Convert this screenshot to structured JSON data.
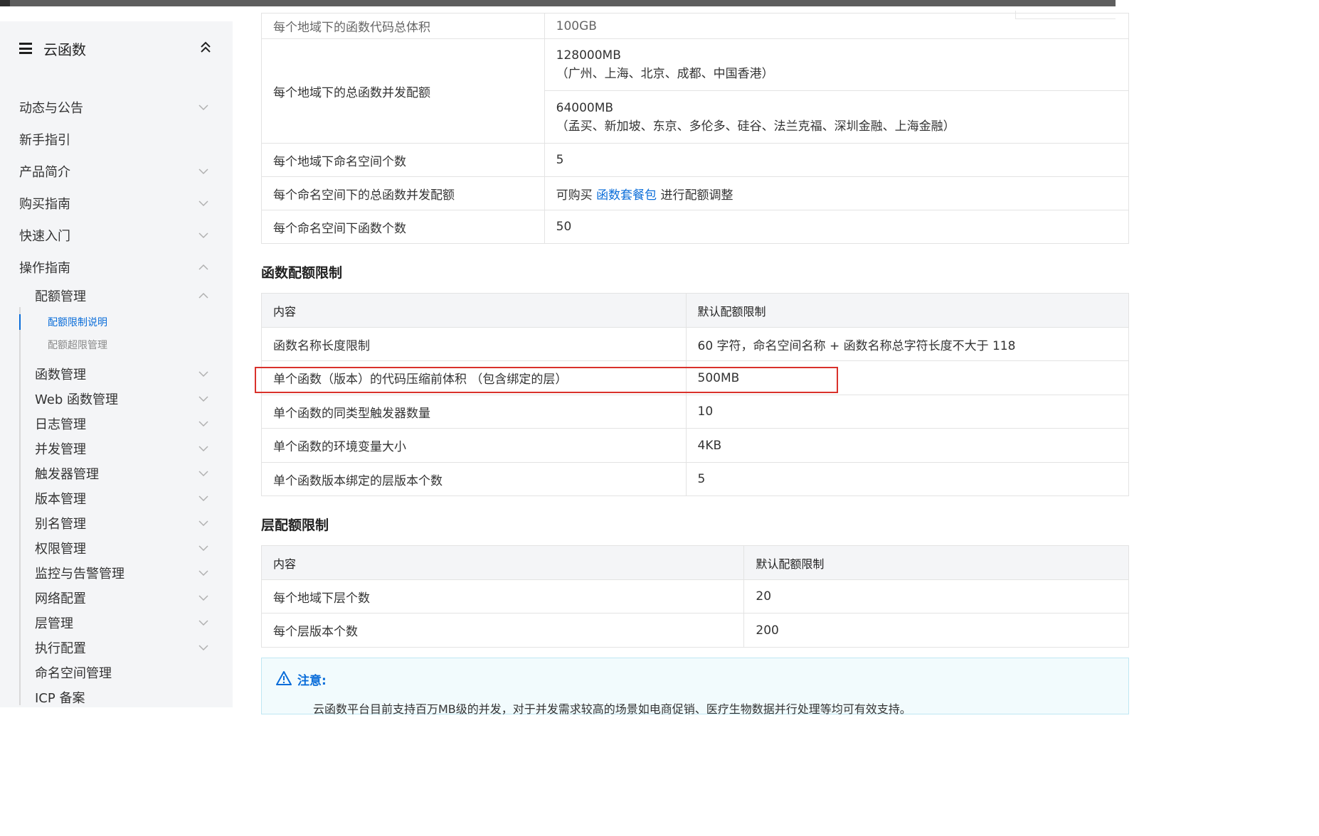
{
  "sidebar": {
    "title": "云函数",
    "items": [
      {
        "label": "动态与公告"
      },
      {
        "label": "新手指引"
      },
      {
        "label": "产品简介"
      },
      {
        "label": "购买指南"
      },
      {
        "label": "快速入门"
      },
      {
        "label": "操作指南"
      }
    ],
    "sub_quota": "配额管理",
    "sub_quota_children": [
      "配额限制说明",
      "配额超限管理"
    ],
    "sub_items": [
      {
        "label": "函数管理"
      },
      {
        "label": "Web 函数管理"
      },
      {
        "label": "日志管理"
      },
      {
        "label": "并发管理"
      },
      {
        "label": "触发器管理"
      },
      {
        "label": "版本管理"
      },
      {
        "label": "别名管理"
      },
      {
        "label": "权限管理"
      },
      {
        "label": "监控与告警管理"
      },
      {
        "label": "网络配置"
      },
      {
        "label": "层管理"
      },
      {
        "label": "执行配置"
      },
      {
        "label": "命名空间管理"
      },
      {
        "label": "ICP 备案"
      }
    ]
  },
  "top_table": {
    "partial_row": {
      "name": "每个地域下的函数代码总体积",
      "value": "100GB"
    },
    "concurrency": {
      "name": "每个地域下的总函数并发配额",
      "v1": "128000MB",
      "v1_regions": "（广州、上海、北京、成都、中国香港）",
      "v2": "64000MB",
      "v2_regions": "（孟买、新加坡、东京、多伦多、硅谷、法兰克福、深圳金融、上海金融）"
    },
    "rows": [
      {
        "name": "每个地域下命名空间个数",
        "value": "5"
      },
      {
        "name": "每个命名空间下的总函数并发配额",
        "value_pre": "可购买",
        "value_link": "函数套餐包",
        "value_post": "进行配额调整"
      },
      {
        "name": "每个命名空间下函数个数",
        "value": "50"
      }
    ]
  },
  "function_quota": {
    "title": "函数配额限制",
    "headers": [
      "内容",
      "默认配额限制"
    ],
    "rows": [
      [
        "函数名称长度限制",
        "60 字符，命名空间名称 + 函数名称总字符长度不大于 118"
      ],
      [
        "单个函数（版本）的代码压缩前体积 （包含绑定的层）",
        "500MB"
      ],
      [
        "单个函数的同类型触发器数量",
        "10"
      ],
      [
        "单个函数的环境变量大小",
        "4KB"
      ],
      [
        "单个函数版本绑定的层版本个数",
        "5"
      ]
    ]
  },
  "layer_quota": {
    "title": "层配额限制",
    "headers": [
      "内容",
      "默认配额限制"
    ],
    "rows": [
      [
        "每个地域下层个数",
        "20"
      ],
      [
        "每个层版本个数",
        "200"
      ]
    ]
  },
  "notice": {
    "label": "注意:",
    "text": "云函数平台目前支持百万MB级的并发，对于并发需求较高的场景如电商促销、医疗生物数据并行处理等均可有效支持。"
  },
  "colors": {
    "accent": "#0a6dd9",
    "highlight": "#d9312b",
    "sidebar_bg": "#f4f5f7"
  }
}
